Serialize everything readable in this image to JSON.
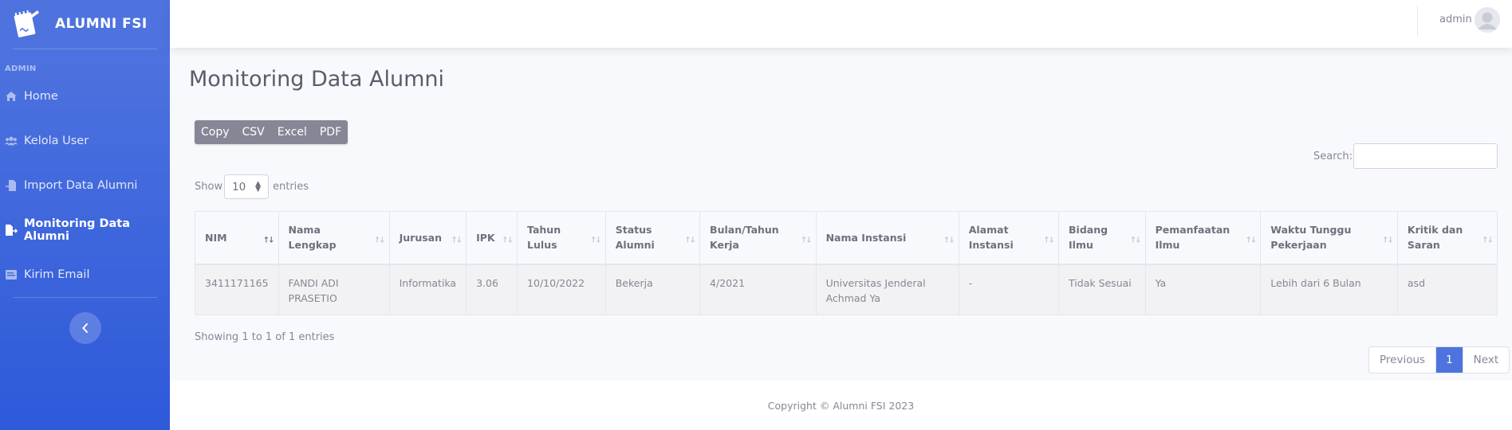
{
  "sidebar": {
    "brand": "ALUMNI FSI",
    "heading": "ADMIN",
    "items": [
      {
        "label": "Home",
        "icon": "home-icon"
      },
      {
        "label": "Kelola User",
        "icon": "users-icon"
      },
      {
        "label": "Import Data Alumni",
        "icon": "file-import-icon"
      },
      {
        "label": "Monitoring Data Alumni",
        "icon": "file-export-icon",
        "active": true
      },
      {
        "label": "Kirim Email",
        "icon": "email-icon"
      }
    ],
    "toggle_icon": "chevron-left-icon"
  },
  "topbar": {
    "user": "admin",
    "avatar_icon": "user-avatar-icon"
  },
  "main": {
    "title": "Monitoring Data Alumni",
    "export_buttons": [
      "Copy",
      "CSV",
      "Excel",
      "PDF"
    ],
    "search_label": "Search:",
    "search_value": "",
    "show_label": "Show",
    "page_size": "10",
    "entries_label": "entries",
    "table": {
      "columns": [
        {
          "line1": "NIM",
          "line2": ""
        },
        {
          "line1": "Nama Lengkap",
          "line2": ""
        },
        {
          "line1": "Jurusan",
          "line2": ""
        },
        {
          "line1": "IPK",
          "line2": ""
        },
        {
          "line1": "Tahun",
          "line2": "Lulus"
        },
        {
          "line1": "Status",
          "line2": "Alumni"
        },
        {
          "line1": "Bulan/Tahun",
          "line2": "Kerja"
        },
        {
          "line1": "Nama Instansi",
          "line2": ""
        },
        {
          "line1": "Alamat",
          "line2": "Instansi"
        },
        {
          "line1": "Bidang",
          "line2": "Ilmu"
        },
        {
          "line1": "Pemanfaatan",
          "line2": "Ilmu"
        },
        {
          "line1": "Waktu Tunggu",
          "line2": "Pekerjaan"
        },
        {
          "line1": "Kritik dan",
          "line2": "Saran"
        }
      ],
      "rows": [
        [
          {
            "line1": "3411171165",
            "line2": ""
          },
          {
            "line1": "FANDI ADI",
            "line2": "PRASETIO"
          },
          {
            "line1": "Informatika",
            "line2": ""
          },
          {
            "line1": "3.06",
            "line2": ""
          },
          {
            "line1": "10/10/2022",
            "line2": ""
          },
          {
            "line1": "Bekerja",
            "line2": ""
          },
          {
            "line1": "4/2021",
            "line2": ""
          },
          {
            "line1": "Universitas Jenderal",
            "line2": "Achmad Ya"
          },
          {
            "line1": "-",
            "line2": ""
          },
          {
            "line1": "Tidak Sesuai",
            "line2": ""
          },
          {
            "line1": "Ya",
            "line2": ""
          },
          {
            "line1": "Lebih dari 6 Bulan",
            "line2": ""
          },
          {
            "line1": "asd",
            "line2": ""
          }
        ]
      ]
    },
    "info": "Showing 1 to 1 of 1 entries",
    "pagination": {
      "previous": "Previous",
      "current": "1",
      "next": "Next"
    }
  },
  "footer": {
    "text": "Copyright © Alumni FSI 2023"
  },
  "colors": {
    "primary": "#4e73df",
    "sidebar_end": "#2e59d9",
    "text": "#858796",
    "title": "#5a5c69"
  }
}
